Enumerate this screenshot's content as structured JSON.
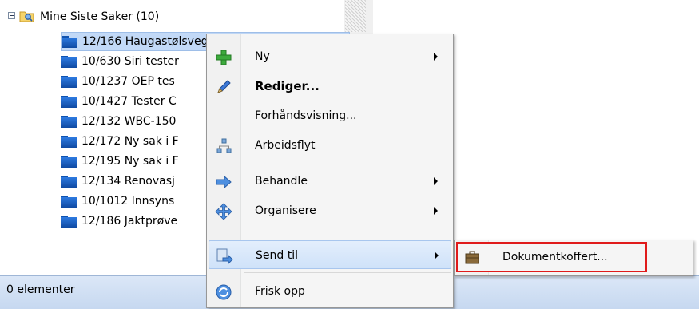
{
  "tree": {
    "root_label": "Mine Siste Saker (10)",
    "items": [
      {
        "label": "12/166 Haugastølsvegen"
      },
      {
        "label": "10/630 Siri tester"
      },
      {
        "label": "10/1237 OEP tes"
      },
      {
        "label": "10/1427 Tester C"
      },
      {
        "label": "12/132 WBC-150"
      },
      {
        "label": "12/172 Ny sak i F"
      },
      {
        "label": "12/195 Ny sak i F"
      },
      {
        "label": "12/134 Renovasj"
      },
      {
        "label": "10/1012 Innsyns"
      },
      {
        "label": "12/186 Jaktprøve"
      }
    ]
  },
  "status_bar": {
    "text": "0 elementer"
  },
  "context_menu": {
    "items": [
      {
        "label": "Ny",
        "icon": "green-plus-icon"
      },
      {
        "label": "Rediger...",
        "icon": "pencil-icon"
      },
      {
        "label": "Forhåndsvisning...",
        "icon": ""
      },
      {
        "label": "Arbeidsflyt",
        "icon": "workflow-icon"
      },
      {
        "label": "Behandle",
        "icon": "process-arrow-icon"
      },
      {
        "label": "Organisere",
        "icon": "organize-arrows-icon"
      },
      {
        "label": "Send til",
        "icon": "send-to-icon"
      },
      {
        "label": "Frisk opp",
        "icon": "refresh-icon"
      }
    ]
  },
  "submenu": {
    "items": [
      {
        "label": "Dokumentkoffert...",
        "icon": "briefcase-icon"
      }
    ]
  },
  "colors": {
    "selection": "#c2d9f7",
    "highlight_border": "#e01b1b",
    "status_bar": "#c6d8f0"
  }
}
